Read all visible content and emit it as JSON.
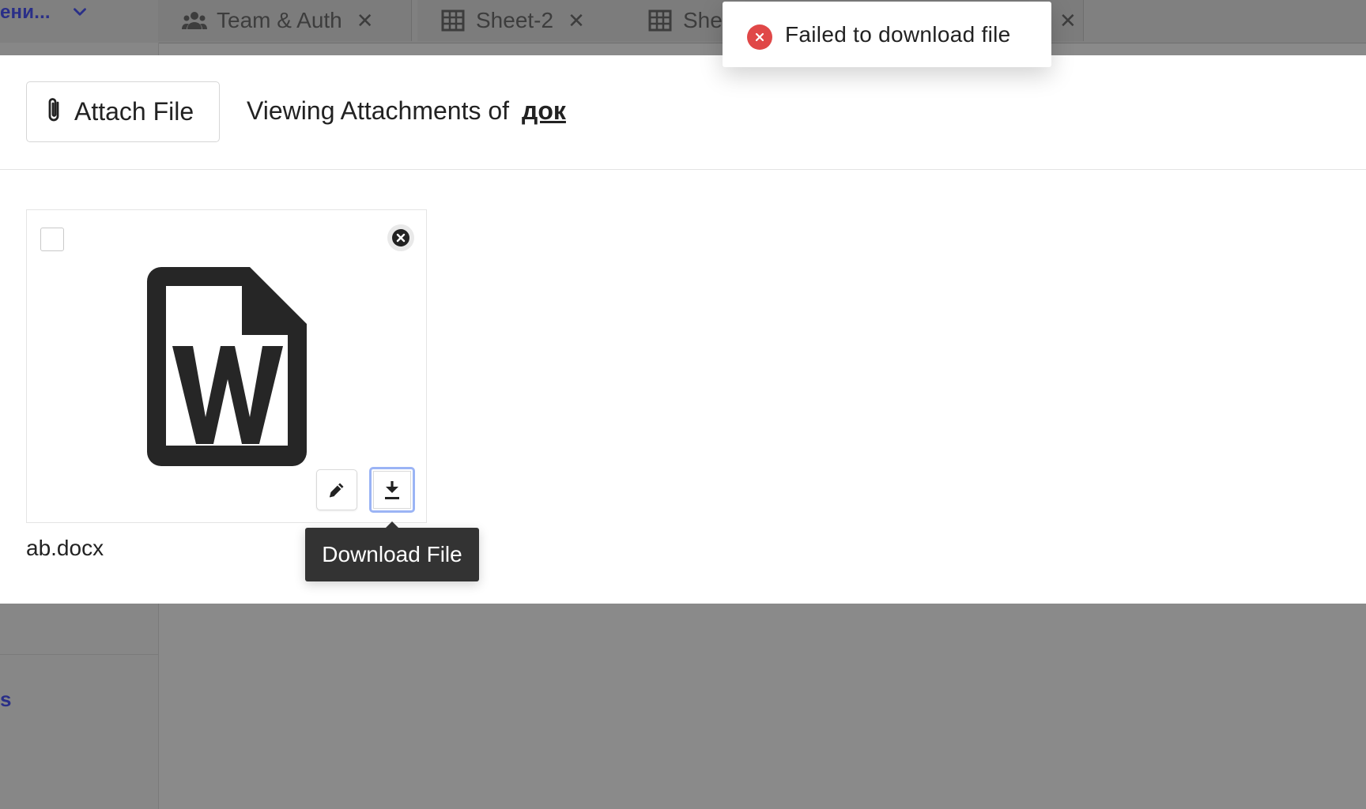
{
  "workspace": {
    "name": "ени..."
  },
  "tabs": [
    {
      "label": "Team & Auth",
      "icon": "team-icon"
    },
    {
      "label": "Sheet-2",
      "icon": "grid-icon"
    },
    {
      "label": "She",
      "icon": "grid-icon"
    }
  ],
  "sidebar": {
    "link_label": "s"
  },
  "modal": {
    "attach_button_label": "Attach File",
    "viewing_prefix": "Viewing Attachments of",
    "record_name": "док",
    "attachments": [
      {
        "filename": "ab.docx",
        "icon": "word-file-icon"
      }
    ]
  },
  "tooltip": {
    "text": "Download File"
  },
  "toast": {
    "message": "Failed to download file",
    "type": "error"
  },
  "colors": {
    "overlay": "#8a8a8a",
    "error": "#e04848",
    "focus_ring": "#9bb4f5",
    "tooltip_bg": "#333333",
    "link_dark_blue": "#2a2f88"
  }
}
